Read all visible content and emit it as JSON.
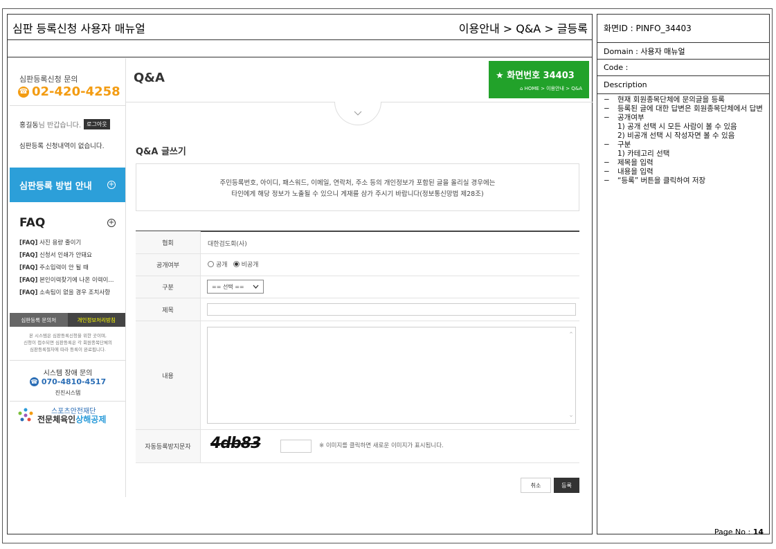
{
  "manual": {
    "title": "심판 등록신청 사용자 매뉴얼",
    "breadcrumb": "이용안내 > Q&A > 글등록"
  },
  "info_panel": {
    "screen_id": "화면ID : PINFO_34403",
    "domain": "Domain : 사용자 매뉴얼",
    "code": "Code :",
    "description_label": "Description",
    "description_items": [
      {
        "text": "현재 회원종목단체에 문의글을 등록",
        "sub": false
      },
      {
        "text": "등록된 글에 대한 답변은 회원종목단체에서 답변",
        "sub": false
      },
      {
        "text": "공개여부",
        "sub": false
      },
      {
        "text": "1) 공개 선택 시 모든 사람이 볼 수 있음",
        "sub": true
      },
      {
        "text": "2) 비공개 선택 시 작성자면 볼 수 있음",
        "sub": true
      },
      {
        "text": "구분",
        "sub": false
      },
      {
        "text": "1) 카테고리 선택",
        "sub": true
      },
      {
        "text": "제목을 입력",
        "sub": false
      },
      {
        "text": "내용을 입력",
        "sub": false
      },
      {
        "text": "“등록” 버튼을 클릭하여 저장",
        "sub": false
      }
    ],
    "page_label": "Page No :",
    "page_number": "14"
  },
  "sidebar": {
    "contact_label": "심판등록신청 문의",
    "contact_phone": "02-420-4258",
    "user_name": "홍길동",
    "greeting_suffix": "님 반갑습니다.",
    "logout_label": "로그아웃",
    "status_text": "심판등록 신청내역이 없습니다.",
    "guide_button": "심판등록 방법 안내",
    "faq_title": "FAQ",
    "faq_tag": "[FAQ]",
    "faq_items": [
      "사진 용량 줄이기",
      "신청서 인쇄가 안돼요",
      "주소입력이 안 될 때",
      "본인이력찾기에 나온 이력이...",
      "소속팀이 없을 경우 조치사항"
    ],
    "tab_contact": "심판등록 문의처",
    "tab_privacy": "개인정보처리방침",
    "notice_line1": "본 시스템은 심판등록신청을 위한 곳이며,",
    "notice_line2": "신청이 접수되면 심판등록은 각 회원종목단체의",
    "notice_line3": "심판등록절차에 따라 등록이 완료됩니다.",
    "system_label": "시스템 장애 문의",
    "system_phone": "070-4810-4517",
    "system_name": "진진시스템",
    "logo_line1": "스포츠안전재단",
    "logo_line2_a": "전문체육인",
    "logo_line2_b": "상해공제"
  },
  "main": {
    "page_title": "Q&A",
    "badge_title": "화면번호 34403",
    "badge_crumb": "HOME > 이용안내 > Q&A",
    "form_title": "Q&A 글쓰기",
    "notice_line1": "주민등록번호, 아이디, 패스워드, 이메일, 연락처, 주소 등의 개인정보가 포함된 글을 올리실 경우에는",
    "notice_line2": "타인에게 해당 정보가 노출될 수 있으니 게재를 삼가 주시기 바랍니다(정보통신망법 제28조)",
    "form": {
      "assoc_label": "협회",
      "assoc_value": "대한검도회(사)",
      "public_label": "공개여부",
      "public_option": "공개",
      "private_option": "비공개",
      "selected": "비공개",
      "category_label": "구분",
      "category_value": "== 선택 ==",
      "title_label": "제목",
      "title_value": "",
      "content_label": "내용",
      "content_value": "",
      "captcha_label": "자동등록방지문자",
      "captcha_text": "4db83",
      "captcha_hint": "※ 이미지를 클릭하면 새로운 이미지가 표시됩니다."
    },
    "cancel_label": "취소",
    "submit_label": "등록"
  },
  "colors": {
    "phone_orange": "#f39c12",
    "guide_blue": "#2c9fd9",
    "badge_green": "#22a22a"
  }
}
